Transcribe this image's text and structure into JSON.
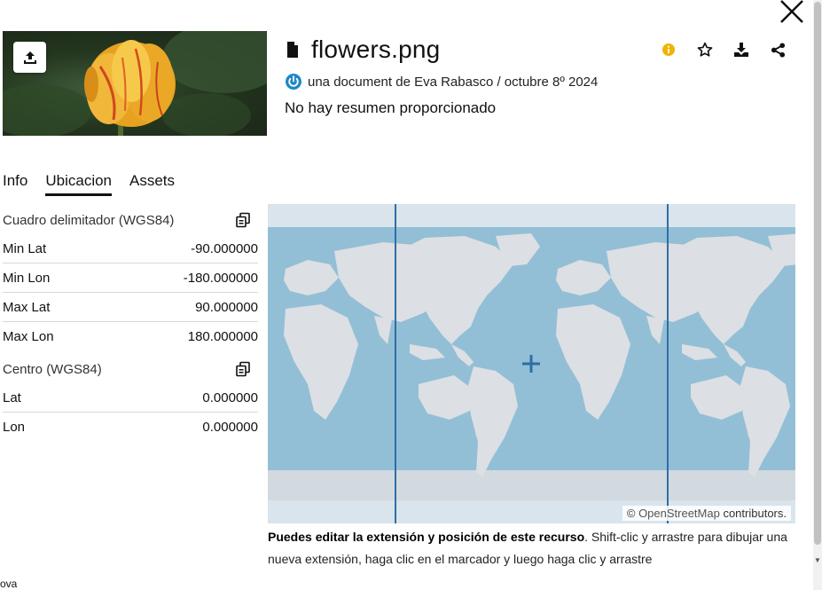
{
  "header": {
    "title": "flowers.png",
    "meta": "una document de Eva Rabasco / octubre 8º 2024",
    "summary": "No hay resumen proporcionado"
  },
  "icons": {
    "file": "file-icon",
    "info": "info-icon",
    "favorite": "star-icon",
    "download": "download-icon",
    "share": "share-icon",
    "upload": "upload-icon",
    "close": "close-icon",
    "copy": "copy-icon"
  },
  "tabs": [
    {
      "label": "Info",
      "active": false
    },
    {
      "label": "Ubicacion",
      "active": true
    },
    {
      "label": "Assets",
      "active": false
    }
  ],
  "bbox": {
    "title": "Cuadro delimitador (WGS84)",
    "rows": [
      {
        "label": "Min Lat",
        "value": "-90.000000"
      },
      {
        "label": "Min Lon",
        "value": "-180.000000"
      },
      {
        "label": "Max Lat",
        "value": "90.000000"
      },
      {
        "label": "Max Lon",
        "value": "180.000000"
      }
    ]
  },
  "center": {
    "title": "Centro (WGS84)",
    "rows": [
      {
        "label": "Lat",
        "value": "0.000000"
      },
      {
        "label": "Lon",
        "value": "0.000000"
      }
    ]
  },
  "map": {
    "attribution_prefix": "© ",
    "attribution_link": "OpenStreetMap",
    "attribution_suffix": " contributors."
  },
  "caption": {
    "bold": "Puedes editar la extensión y posición de este recurso",
    "text": ". Shift-clic y arrastre para dibujar una nueva extensión, haga clic en el marcador y luego haga clic y arrastre"
  },
  "bottom_text": "ova",
  "colors": {
    "info": "#f0b400",
    "power": "#1e88c7",
    "ocean": "#93bfd6",
    "land": "#dcdfe3",
    "extent_line": "#2f6ea6"
  }
}
